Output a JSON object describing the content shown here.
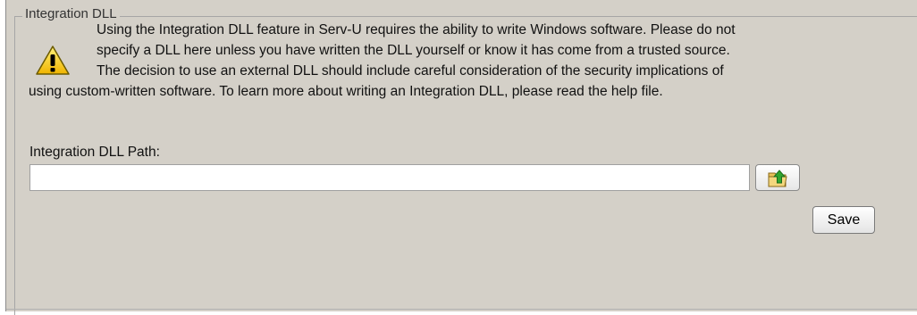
{
  "groupbox": {
    "title": "Integration DLL"
  },
  "warning": {
    "icon": "warning-icon",
    "lines": [
      "Using the Integration DLL feature in Serv-U requires the ability to write Windows software. Please do not",
      "specify a DLL here unless you have written the DLL yourself or know it has come from a trusted source.",
      "The decision to use an external DLL should include careful consideration of the security implications of",
      "using custom-written software. To learn more about writing an Integration DLL, please read the help file."
    ]
  },
  "path": {
    "label": "Integration DLL Path:",
    "value": "",
    "placeholder": ""
  },
  "browse_button": {
    "icon": "folder-up-icon"
  },
  "save_button": {
    "label": "Save"
  },
  "colors": {
    "panel_bg": "#d4d0c8",
    "warning_yellow": "#f5c400",
    "folder_yellow": "#e8c25a",
    "arrow_green": "#2fa52f"
  }
}
